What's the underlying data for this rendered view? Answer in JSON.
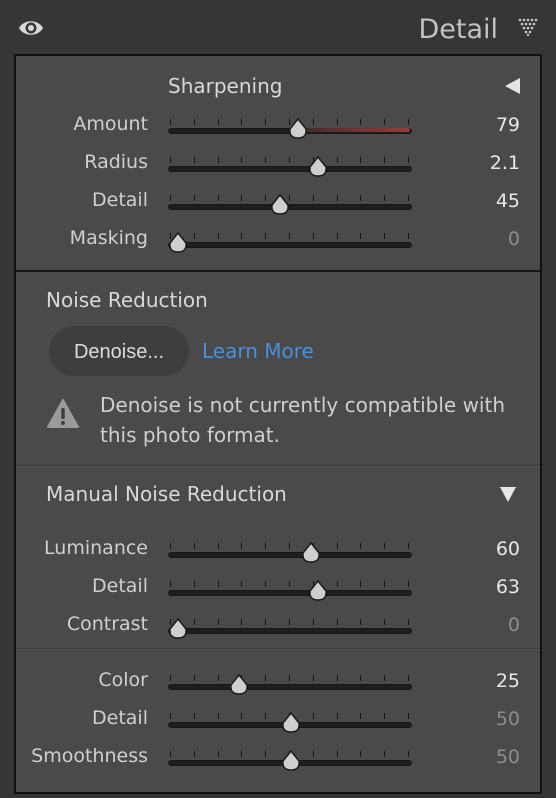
{
  "header": {
    "title": "Detail",
    "eye_icon": "eye-icon",
    "menu_icon": "panel-menu-triangle-icon"
  },
  "sharpening": {
    "title": "Sharpening",
    "toggle_icon": "collapse-left-triangle-icon",
    "rows": [
      {
        "label": "Amount",
        "value": "79",
        "fraction": 0.53,
        "dim": false,
        "glow": true
      },
      {
        "label": "Radius",
        "value": "2.1",
        "fraction": 0.62,
        "dim": false
      },
      {
        "label": "Detail",
        "value": "45",
        "fraction": 0.45,
        "dim": false
      },
      {
        "label": "Masking",
        "value": "0",
        "fraction": 0.0,
        "dim": true
      }
    ]
  },
  "noise_reduction": {
    "title": "Noise Reduction",
    "denoise_button": "Denoise...",
    "learn_more": "Learn More",
    "warning": "Denoise is not currently compatible with this photo format.",
    "warning_icon": "warning-triangle-icon"
  },
  "manual_noise_reduction": {
    "title": "Manual Noise Reduction",
    "toggle_icon": "expand-down-triangle-icon",
    "luminance_rows": [
      {
        "label": "Luminance",
        "value": "60",
        "fraction": 0.59,
        "dim": false
      },
      {
        "label": "Detail",
        "value": "63",
        "fraction": 0.62,
        "dim": false
      },
      {
        "label": "Contrast",
        "value": "0",
        "fraction": 0.0,
        "dim": true
      }
    ],
    "color_rows": [
      {
        "label": "Color",
        "value": "25",
        "fraction": 0.27,
        "dim": false
      },
      {
        "label": "Detail",
        "value": "50",
        "fraction": 0.5,
        "dim": true
      },
      {
        "label": "Smoothness",
        "value": "50",
        "fraction": 0.5,
        "dim": true
      }
    ]
  },
  "colors": {
    "accent_link": "#4a8fd9",
    "amount_glow": "#9a3a3a"
  }
}
